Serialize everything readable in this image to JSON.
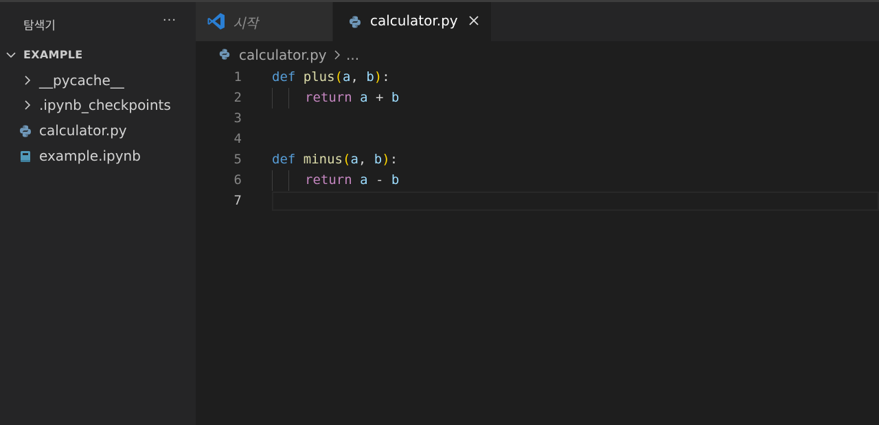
{
  "explorer": {
    "title": "탐색기",
    "more_label": "···",
    "section": "EXAMPLE",
    "items": [
      {
        "label": "__pycache__",
        "type": "folder"
      },
      {
        "label": ".ipynb_checkpoints",
        "type": "folder"
      },
      {
        "label": "calculator.py",
        "type": "python"
      },
      {
        "label": "example.ipynb",
        "type": "notebook"
      }
    ]
  },
  "tabs": [
    {
      "label": "시작",
      "active": false
    },
    {
      "label": "calculator.py",
      "active": true
    }
  ],
  "breadcrumb": {
    "file": "calculator.py",
    "more": "..."
  },
  "editor": {
    "line_numbers": [
      "1",
      "2",
      "3",
      "4",
      "5",
      "6",
      "7"
    ],
    "current_line": 7,
    "code": {
      "l1": {
        "def": "def",
        "name": "plus",
        "open": "(",
        "a": "a",
        "comma": ", ",
        "b": "b",
        "close": ")",
        "colon": ":"
      },
      "l2": {
        "ret": "return",
        "a": "a",
        "op": " + ",
        "b": "b"
      },
      "l5": {
        "def": "def",
        "name": "minus",
        "open": "(",
        "a": "a",
        "comma": ", ",
        "b": "b",
        "close": ")",
        "colon": ":"
      },
      "l6": {
        "ret": "return",
        "a": "a",
        "op": " - ",
        "b": "b"
      }
    }
  },
  "colors": {
    "background": "#1e1e1e",
    "sidebar": "#252526",
    "keyword_def": "#569cd6",
    "keyword_return": "#c586c0",
    "function": "#dcdcaa",
    "parameter": "#9cdcfe",
    "paren": "#ffd700"
  },
  "icons": {
    "tab_start": "vscode-logo-icon",
    "tab_calc": "python-icon",
    "close": "close-icon",
    "chevron_down": "chevron-down-icon",
    "chevron_right": "chevron-right-icon",
    "notebook": "notebook-icon"
  }
}
